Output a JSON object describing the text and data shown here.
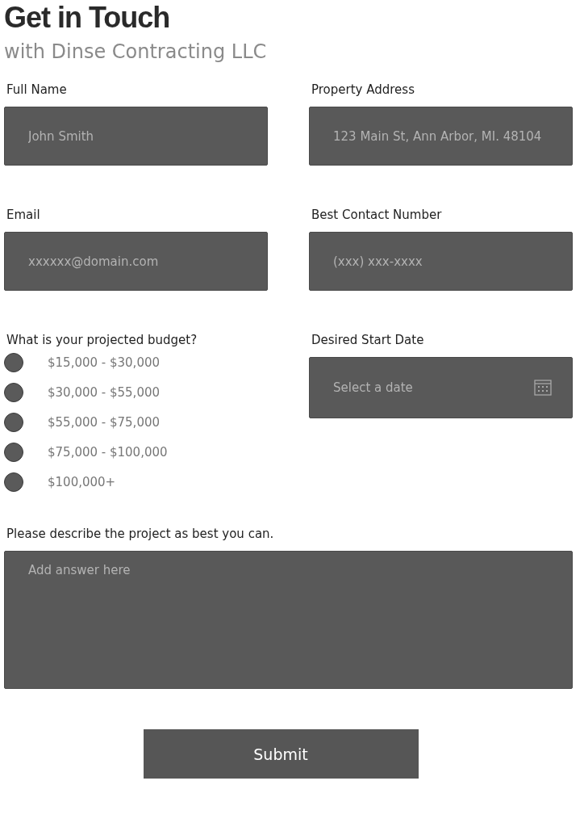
{
  "title": "Get in Touch",
  "subtitle": "with Dinse Contracting LLC",
  "fields": [
    {
      "label": "Full Name",
      "placeholder": "John Smith"
    },
    {
      "label": "Property Address",
      "placeholder": "123 Main St, Ann Arbor, MI. 48104"
    },
    {
      "label": "Email",
      "placeholder": "xxxxxx@domain.com"
    },
    {
      "label": "Best Contact Number",
      "placeholder": "(xxx) xxx-xxxx"
    }
  ],
  "budget": {
    "label": "What is your projected budget?",
    "options": [
      {
        "label": "$15,000 - $30,000",
        "selected": false
      },
      {
        "label": "$30,000 - $55,000",
        "selected": false
      },
      {
        "label": "$55,000 - $75,000",
        "selected": false
      },
      {
        "label": "$75,000 - $100,000",
        "selected": false
      },
      {
        "label": "$100,000+",
        "selected": false
      }
    ]
  },
  "start_date": {
    "label": "Desired Start Date",
    "placeholder": "Select a date"
  },
  "description": {
    "label": "Please describe the project as best you can.",
    "placeholder": "Add answer here"
  },
  "submit": "Submit"
}
